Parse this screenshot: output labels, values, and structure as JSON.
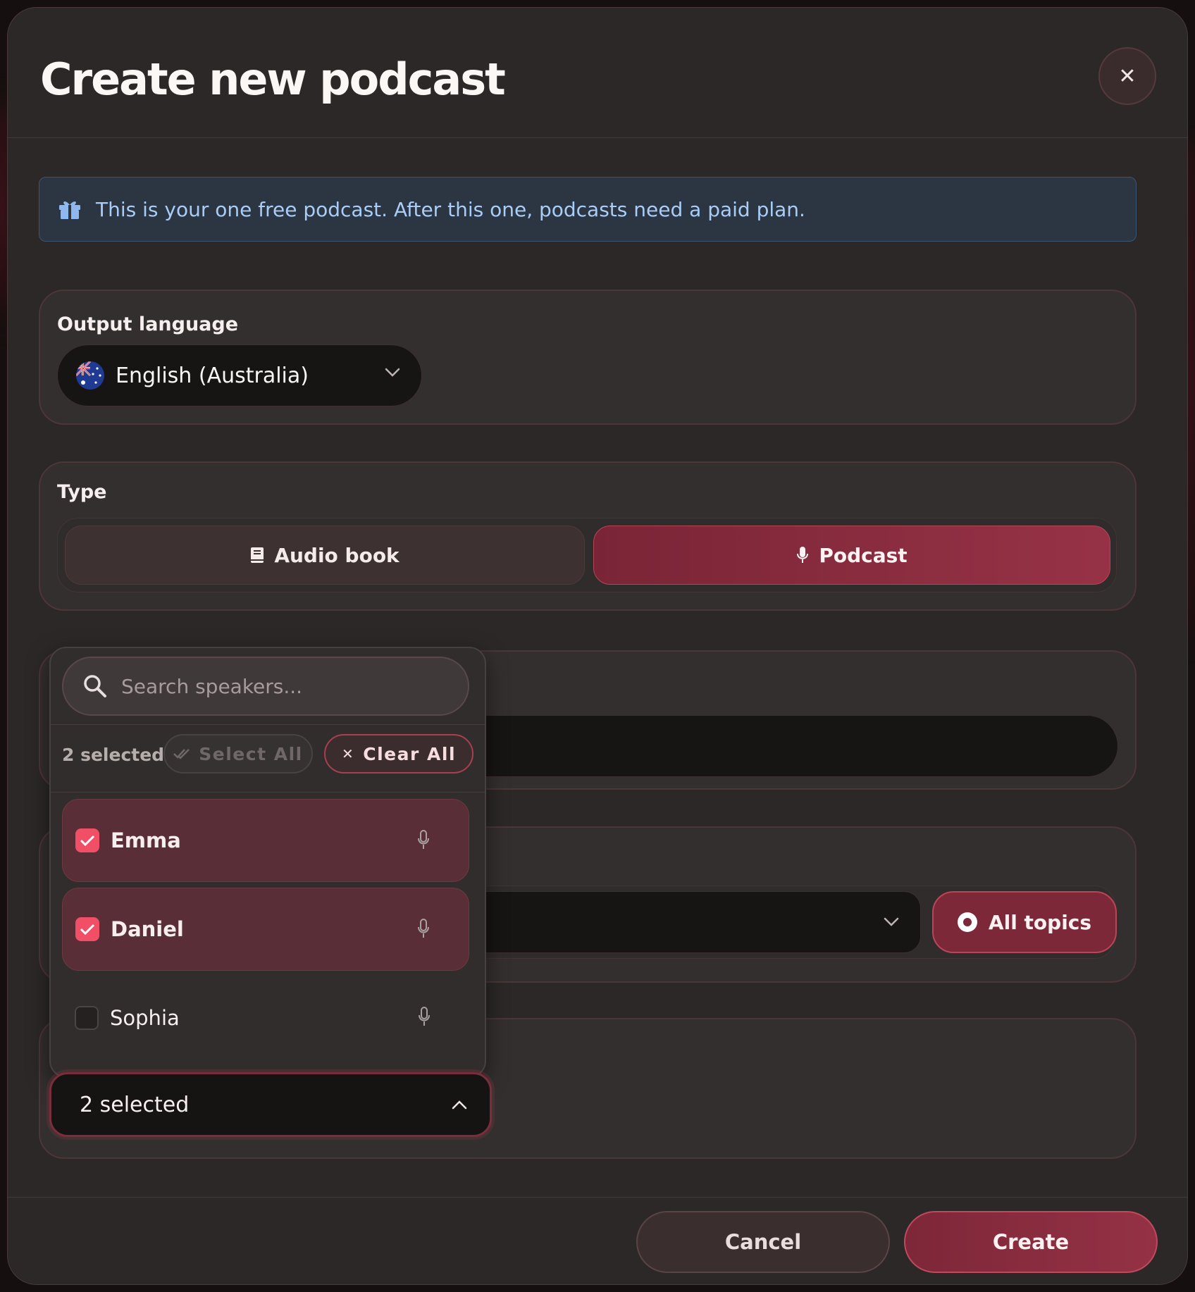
{
  "dialog": {
    "title": "Create new podcast",
    "close_icon": "close-icon"
  },
  "notice": {
    "icon": "gift-icon",
    "text": "This is your one free podcast. After this one, podcasts need a paid plan."
  },
  "output_language": {
    "label": "Output language",
    "selected": "English (Australia)",
    "flag_icon": "australia-flag-icon"
  },
  "type": {
    "label": "Type",
    "options": [
      {
        "label": "Audio book",
        "icon": "book-icon",
        "selected": false
      },
      {
        "label": "Podcast",
        "icon": "microphone-icon",
        "selected": true
      }
    ]
  },
  "topics": {
    "all_topics_label": "All topics"
  },
  "speakers": {
    "search_placeholder": "Search speakers...",
    "selected_count_text": "2 selected",
    "select_all_label": "Select All",
    "clear_all_label": "Clear All",
    "options": [
      {
        "name": "Emma",
        "checked": true
      },
      {
        "name": "Daniel",
        "checked": true
      },
      {
        "name": "Sophia",
        "checked": false
      }
    ],
    "trigger_value": "2 selected"
  },
  "footer": {
    "cancel_label": "Cancel",
    "create_label": "Create"
  },
  "colors": {
    "accent": "#973246",
    "checkbox_on": "#f04f66",
    "notice_text": "#a9cdf7"
  }
}
